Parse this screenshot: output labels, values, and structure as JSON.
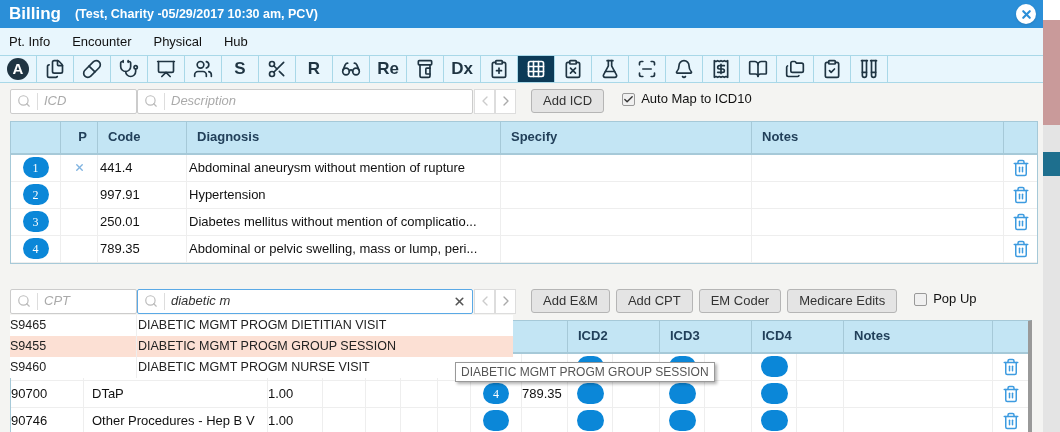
{
  "window": {
    "title": "Billing",
    "subtitle": "(Test, Charity -05/29/2017 10:30 am, PCV)"
  },
  "menu": [
    "Pt. Info",
    "Encounter",
    "Physical",
    "Hub"
  ],
  "toolbar": [
    {
      "kind": "letter",
      "label": "A",
      "round": true,
      "selected": false
    },
    {
      "kind": "icon",
      "selected": false
    },
    {
      "kind": "icon",
      "selected": false
    },
    {
      "kind": "icon",
      "selected": false
    },
    {
      "kind": "icon",
      "selected": false
    },
    {
      "kind": "icon",
      "selected": false
    },
    {
      "kind": "letter",
      "label": "S",
      "round": false,
      "selected": false
    },
    {
      "kind": "icon",
      "selected": false
    },
    {
      "kind": "letter",
      "label": "R",
      "round": false,
      "selected": false
    },
    {
      "kind": "icon",
      "selected": false
    },
    {
      "kind": "letter",
      "label": "Re",
      "round": false,
      "selected": false
    },
    {
      "kind": "icon",
      "selected": false
    },
    {
      "kind": "letter",
      "label": "Dx",
      "round": false,
      "selected": false
    },
    {
      "kind": "icon",
      "selected": false
    },
    {
      "kind": "icon",
      "selected": true
    },
    {
      "kind": "icon",
      "selected": false
    },
    {
      "kind": "icon",
      "selected": false
    },
    {
      "kind": "icon",
      "selected": false
    },
    {
      "kind": "icon",
      "selected": false
    },
    {
      "kind": "icon",
      "selected": false
    },
    {
      "kind": "icon",
      "selected": false
    },
    {
      "kind": "icon",
      "selected": false
    },
    {
      "kind": "icon",
      "selected": false
    },
    {
      "kind": "icon",
      "selected": false
    }
  ],
  "icd_search": {
    "code_placeholder": "ICD",
    "description_placeholder": "Description",
    "add_button": "Add ICD",
    "auto_map": {
      "label": "Auto Map to ICD10",
      "checked": true
    }
  },
  "icd_table": {
    "columns": [
      "P",
      "Code",
      "Diagnosis",
      "Specify",
      "Notes"
    ],
    "rows": [
      {
        "num": "1",
        "primary": true,
        "code": "441.4",
        "diagnosis": "Abdominal aneurysm without mention of rupture"
      },
      {
        "num": "2",
        "primary": false,
        "code": "997.91",
        "diagnosis": "Hypertension"
      },
      {
        "num": "3",
        "primary": false,
        "code": "250.01",
        "diagnosis": "Diabetes mellitus without mention of complicatio..."
      },
      {
        "num": "4",
        "primary": false,
        "code": "789.35",
        "diagnosis": "Abdominal or pelvic swelling, mass or lump, peri..."
      }
    ]
  },
  "cpt_search": {
    "code_placeholder": "CPT",
    "value": "diabetic m",
    "buttons": [
      "Add E&M",
      "Add CPT",
      "EM Coder",
      "Medicare Edits"
    ],
    "popup": {
      "label": "Pop Up",
      "checked": false
    }
  },
  "suggestions": [
    {
      "code": "S9465",
      "description": "DIABETIC MGMT PROGM DIETITIAN VISIT",
      "selected": false
    },
    {
      "code": "S9455",
      "description": "DIABETIC MGMT PROGM GROUP SESSION",
      "selected": true
    },
    {
      "code": "S9460",
      "description": "DIABETIC MGMT PROGM NURSE VISIT",
      "selected": false
    }
  ],
  "tooltip": "DIABETIC MGMT PROGM GROUP SESSION",
  "cpt_table": {
    "columns": [
      "ICD2",
      "ICD3",
      "ICD4",
      "Notes"
    ],
    "rows": [
      {},
      {
        "code": "90700",
        "description": "DTaP",
        "units": "1.00",
        "icd1": "4",
        "icd1_code": "789.35"
      },
      {
        "code": "90746",
        "description": "Other Procedures - Hep B V",
        "units": "1.00"
      }
    ]
  }
}
